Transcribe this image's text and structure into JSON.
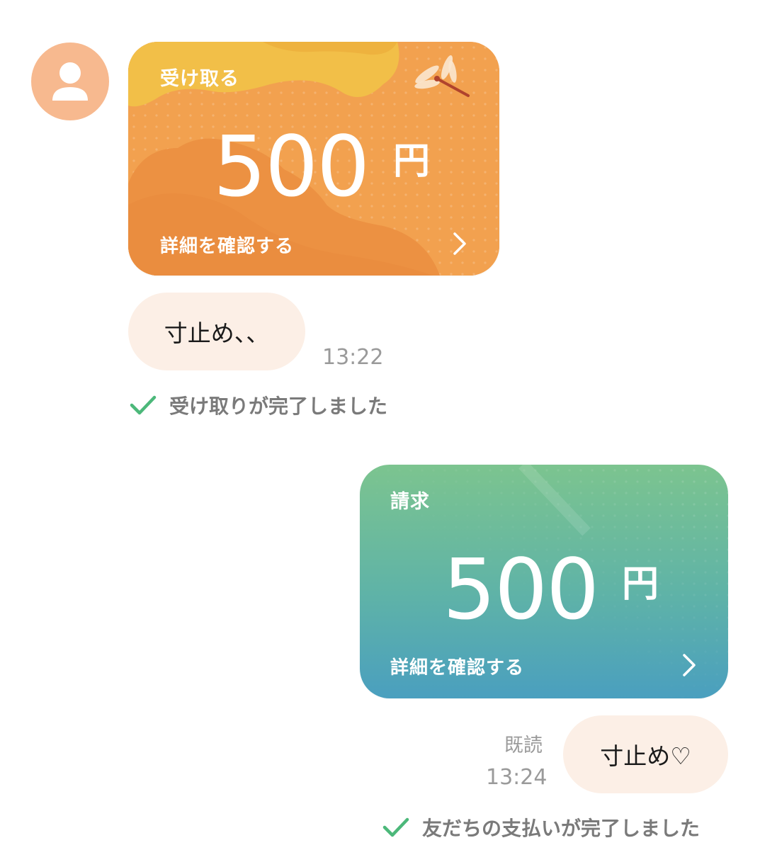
{
  "messages": {
    "incoming_payment": {
      "label": "受け取る",
      "amount": "500",
      "currency": "円",
      "details_label": "詳細を確認する"
    },
    "incoming_text": "寸止め、、",
    "incoming_time": "13:22",
    "incoming_status": "受け取りが完了しました",
    "outgoing_request": {
      "label": "請求",
      "amount": "500",
      "currency": "円",
      "details_label": "詳細を確認する"
    },
    "outgoing_read": "既読",
    "outgoing_time": "13:24",
    "outgoing_text": "寸止め♡",
    "outgoing_status": "友だちの支払いが完了しました"
  },
  "colors": {
    "receive_card": "#ef9a49",
    "request_card_top": "#7cc48f",
    "request_card_bottom": "#4a9fbf",
    "bubble": "#fcefe6",
    "check": "#4cb87a",
    "avatar": "#f7b98f"
  },
  "icons": {
    "avatar": "person-icon",
    "decoration": "dragonfly-icon",
    "chevron": "chevron-right-icon",
    "check": "check-icon"
  }
}
